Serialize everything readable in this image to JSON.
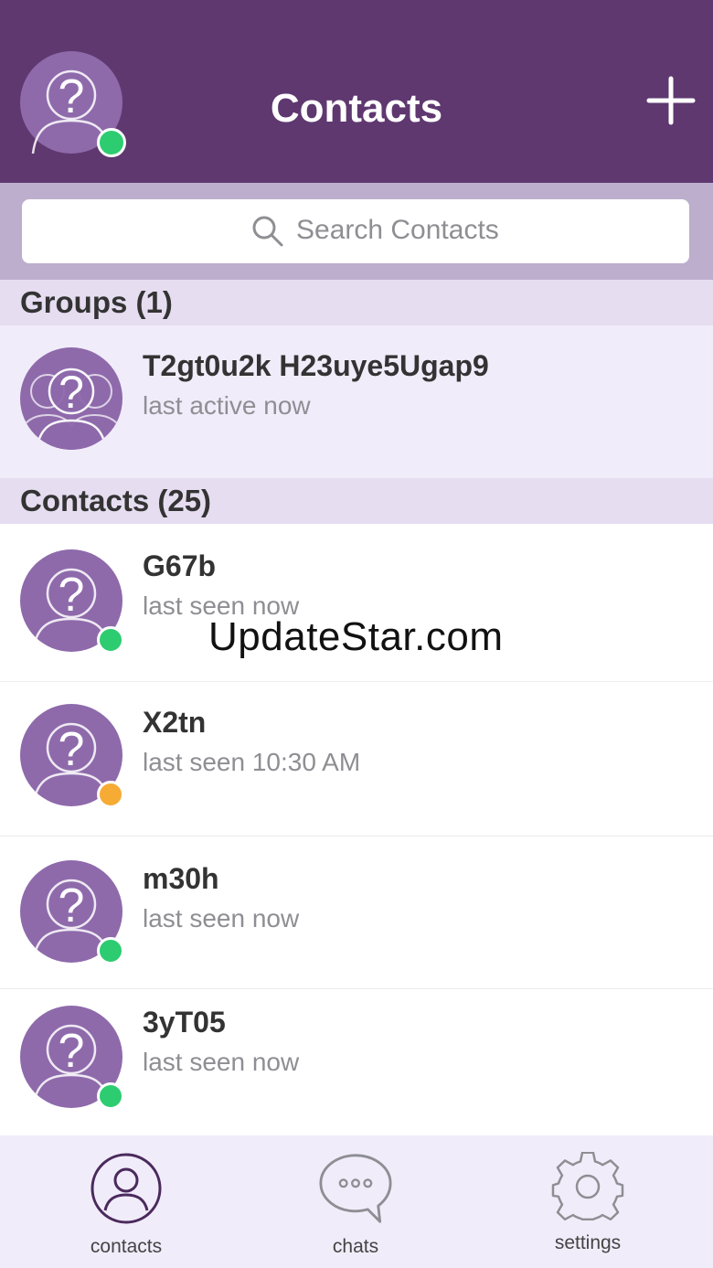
{
  "header": {
    "title": "Contacts",
    "add_icon": "plus-icon",
    "self_status": "online",
    "colors": {
      "bar": "#5f3870",
      "avatar": "#8e6aab",
      "online": "#2ecc71",
      "away": "#f6ab35"
    }
  },
  "search": {
    "placeholder": "Search Contacts",
    "icon": "search-icon"
  },
  "groups": {
    "header": "Groups (1)",
    "items": [
      {
        "name": "T2gt0u2k H23uye5Ugap9",
        "status_text": "last active now"
      }
    ]
  },
  "contacts": {
    "header": "Contacts (25)",
    "items": [
      {
        "name": "G67b",
        "status_text": "last seen now",
        "presence": "online"
      },
      {
        "name": "X2tn",
        "status_text": "last seen 10:30 AM",
        "presence": "away"
      },
      {
        "name": "m30h",
        "status_text": "last seen now",
        "presence": "online"
      },
      {
        "name": "3yT05",
        "status_text": "last seen now",
        "presence": "online"
      }
    ]
  },
  "watermark": "UpdateStar.com",
  "tabs": [
    {
      "label": "contacts",
      "icon": "person-icon",
      "active": true
    },
    {
      "label": "chats",
      "icon": "chat-bubble-icon",
      "active": false
    },
    {
      "label": "settings",
      "icon": "gear-icon",
      "active": false
    }
  ]
}
